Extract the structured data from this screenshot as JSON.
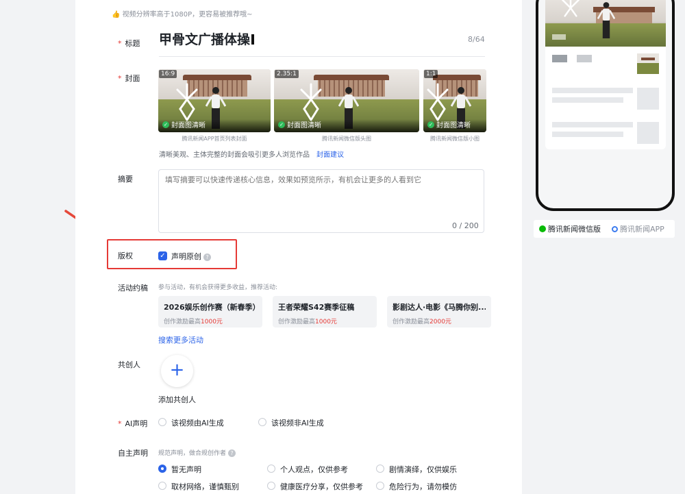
{
  "resolution_tip": "👍 视频分辨率高于1080P，更容易被推荐哦~",
  "labels": {
    "title": "标题",
    "cover": "封面",
    "summary": "摘要",
    "copyright": "版权",
    "activity": "活动约稿",
    "cocreator": "共创人",
    "ai": "AI声明",
    "self": "自主声明"
  },
  "title": {
    "value": "甲骨文广播体操",
    "count": "8/64"
  },
  "covers": [
    {
      "ratio": "16:9",
      "status": "封面图清晰",
      "caption": "腾讯新闻APP首页列表封面"
    },
    {
      "ratio": "2.35:1",
      "status": "封面图清晰",
      "caption": "腾讯新闻微信版头图"
    },
    {
      "ratio": "1:1",
      "status": "封面图清晰",
      "caption": "腾讯新闻微信版小图"
    }
  ],
  "cover_tip": {
    "text": "清晰美观、主体完整的封面会吸引更多人浏览作品",
    "link": "封面建议"
  },
  "summary": {
    "placeholder": "填写摘要可以快速传递核心信息，效果如预览所示，有机会让更多的人看到它",
    "count": "0 / 200"
  },
  "copyright": {
    "label": "声明原创",
    "checked": true
  },
  "activity": {
    "tip": "参与活动，有机会获得更多收益，推荐活动:",
    "cards": [
      {
        "title": "2026娱乐创作赛（新春季）",
        "reward_prefix": "创作激励最高",
        "reward_amount": "1000元"
      },
      {
        "title": "王者荣耀S42赛季征稿",
        "reward_prefix": "创作激励最高",
        "reward_amount": "1000元"
      },
      {
        "title": "影剧达人·电影《马腾你别...",
        "reward_prefix": "创作激励最高",
        "reward_amount": "2000元"
      }
    ],
    "more": "搜索更多活动"
  },
  "cocreator": {
    "add_label": "添加共创人"
  },
  "ai": {
    "options": [
      "该视频由AI生成",
      "该视频非AI生成"
    ]
  },
  "self": {
    "tip": "规范声明，做合规创作者",
    "options": [
      "暂无声明",
      "个人观点，仅供参考",
      "剧情演绎，仅供娱乐",
      "取材网络，谨慎甄别",
      "健康医疗分享，仅供参考",
      "危险行为，请勿模仿"
    ],
    "selected": "暂无声明"
  },
  "preview_tabs": [
    "腾讯新闻微信版",
    "腾讯新闻APP"
  ],
  "colors": {
    "accent": "#2b63e8",
    "required": "#e53935",
    "highlight": "#e53935"
  }
}
